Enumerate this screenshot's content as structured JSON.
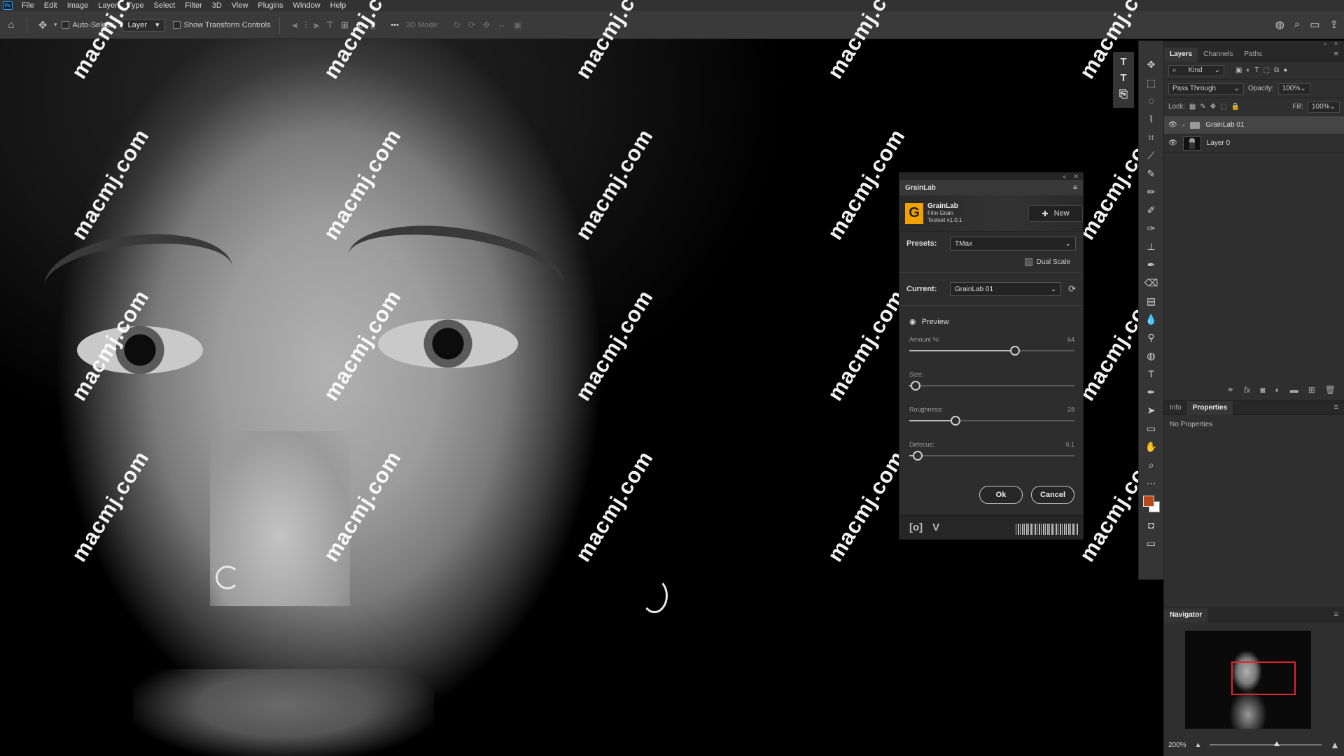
{
  "menubar": {
    "items": [
      "File",
      "Edit",
      "Image",
      "Layer",
      "Type",
      "Select",
      "Filter",
      "3D",
      "View",
      "Plugins",
      "Window",
      "Help"
    ]
  },
  "options": {
    "auto_select": "Auto-Select:",
    "auto_select_target": "Layer",
    "show_transform": "Show Transform Controls",
    "more": "•••",
    "mode_3d": "3D Mode:"
  },
  "watermark": "macmj.com",
  "grainlab": {
    "panel_title": "GrainLab",
    "brand_name": "GrainLab",
    "brand_sub1": "Film Grain",
    "brand_sub2": "Toolset v1.0.1",
    "new_label": "New",
    "presets_label": "Presets:",
    "preset_value": "TMax",
    "dual_scale": "Dual Scale",
    "current_label": "Current:",
    "current_value": "GrainLab 01",
    "preview_label": "Preview",
    "sliders": [
      {
        "name": "Amount %:",
        "value": "64",
        "fraction": 0.64
      },
      {
        "name": "Size:",
        "value": "",
        "fraction": 0.04
      },
      {
        "name": "Roughness:",
        "value": "28",
        "fraction": 0.28
      },
      {
        "name": "Defocus:",
        "value": "0.1",
        "fraction": 0.05
      }
    ],
    "ok": "Ok",
    "cancel": "Cancel",
    "footer_icon": "[o]"
  },
  "layers_panel": {
    "tabs": [
      "Layers",
      "Channels",
      "Paths"
    ],
    "kind": "Kind",
    "blend_mode": "Pass Through",
    "opacity_label": "Opacity:",
    "opacity": "100%",
    "lock_label": "Lock:",
    "fill_label": "Fill:",
    "fill": "100%",
    "layers": [
      {
        "name": "GrainLab 01",
        "type": "group",
        "selected": true
      },
      {
        "name": "Layer 0",
        "type": "pixel",
        "selected": false
      }
    ]
  },
  "properties_panel": {
    "tabs": [
      "Info",
      "Properties"
    ],
    "empty_text": "No Properties"
  },
  "navigator": {
    "title": "Navigator",
    "zoom": "200%",
    "zoom_fraction": 0.6
  },
  "colors": {
    "foreground": "#b84a1a",
    "background": "#ffffff",
    "nav_rect": "#e0262c",
    "grainlab_logo": "#f0a200"
  }
}
